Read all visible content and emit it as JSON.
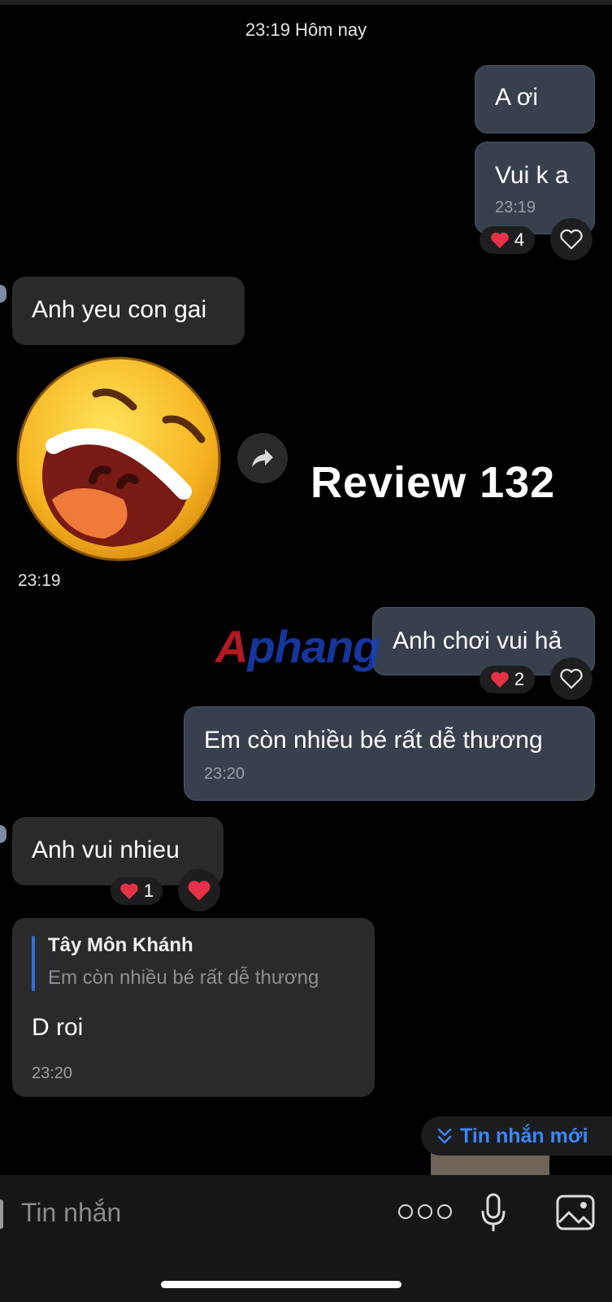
{
  "header": {
    "timestamp": "23:19 Hôm nay"
  },
  "messages": {
    "m1": {
      "text": "A ơi"
    },
    "m2": {
      "text": "Vui k a",
      "time": "23:19",
      "reaction_count": "4"
    },
    "m3": {
      "text": "Anh yeu con gai"
    },
    "sticker": {
      "time": "23:19",
      "icon": "laughing-face-sticker"
    },
    "m4": {
      "text": "Anh chơi vui hả",
      "reaction_count": "2"
    },
    "m5": {
      "text": "Em còn nhiều bé rất dễ thương",
      "time": "23:20"
    },
    "m6": {
      "text": "Anh vui nhieu",
      "reaction_count": "1"
    },
    "m7": {
      "quote_author": "Tây Môn Khánh",
      "quote_text": "Em còn nhiều bé rất dễ thương",
      "text": "D roi",
      "time": "23:20"
    }
  },
  "overlay": {
    "review_text": "Review 132",
    "watermark": "Aphang"
  },
  "new_messages_label": "Tin nhắn mới",
  "composer": {
    "placeholder": "Tin nhắn"
  },
  "colors": {
    "accent": "#3d86f5",
    "heart": "#e53246",
    "me_bubble": "#38404d",
    "them_bubble": "#2a2a2c"
  }
}
